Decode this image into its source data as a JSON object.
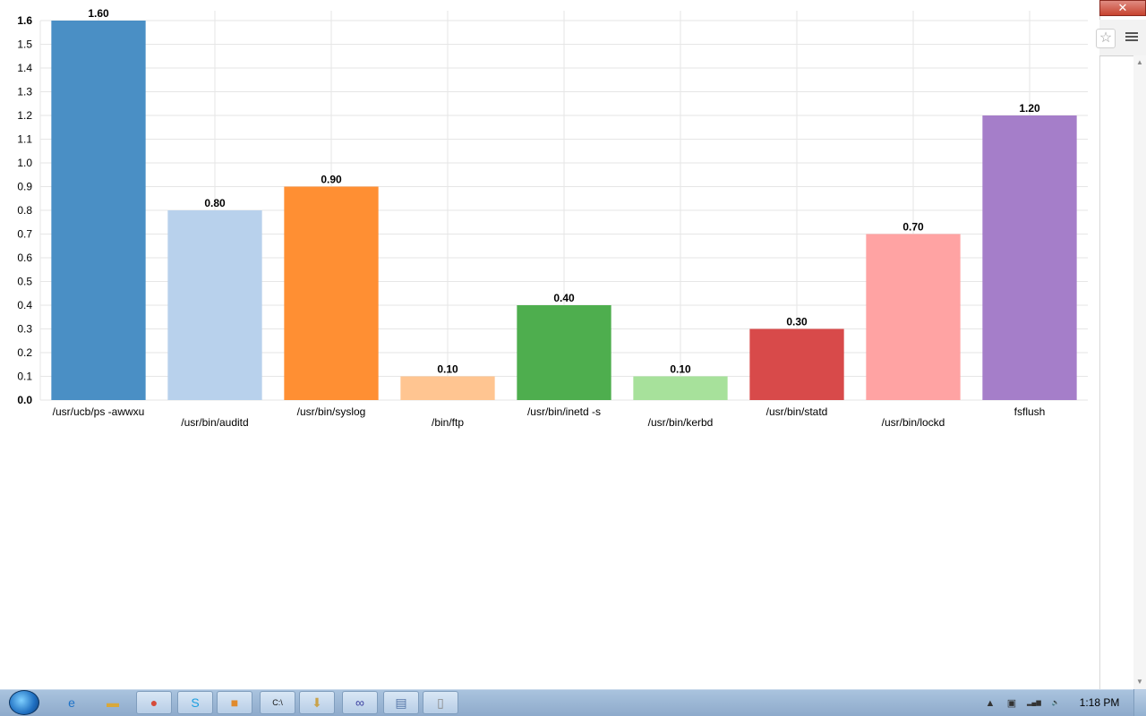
{
  "chart_data": {
    "type": "bar",
    "categories": [
      "/usr/ucb/ps -awwxu",
      "/usr/bin/auditd",
      "/usr/bin/syslog",
      "/bin/ftp",
      "/usr/bin/inetd -s",
      "/usr/bin/kerbd",
      "/usr/bin/statd",
      "/usr/bin/lockd",
      "fsflush"
    ],
    "values": [
      1.6,
      0.8,
      0.9,
      0.1,
      0.4,
      0.1,
      0.3,
      0.7,
      1.2
    ],
    "value_labels": [
      "1.60",
      "0.80",
      "0.90",
      "0.10",
      "0.40",
      "0.10",
      "0.30",
      "0.70",
      "1.20"
    ],
    "colors": [
      "#4a8fc5",
      "#b8d1ec",
      "#ff8f33",
      "#ffc591",
      "#4eae4e",
      "#a7e19b",
      "#d84a4a",
      "#ffa3a3",
      "#a57ec9"
    ],
    "y_ticks": [
      "0.0",
      "0.1",
      "0.2",
      "0.3",
      "0.4",
      "0.5",
      "0.6",
      "0.7",
      "0.8",
      "0.9",
      "1.0",
      "1.1",
      "1.2",
      "1.3",
      "1.4",
      "1.5",
      "1.6"
    ],
    "ylim": [
      0,
      1.6
    ],
    "grid": true,
    "legend": "none",
    "title": "",
    "xlabel": "",
    "ylabel": ""
  },
  "browser": {
    "close_glyph": "✕",
    "star_icon": "star-icon",
    "menu_icon": "menu-icon"
  },
  "taskbar": {
    "clock": "1:18 PM",
    "items": [
      {
        "name": "internet-explorer-icon",
        "glyph": "e",
        "color": "#1e73c8"
      },
      {
        "name": "folder-icon",
        "glyph": "▬",
        "color": "#d9a83a"
      },
      {
        "name": "chrome-icon",
        "glyph": "●",
        "color": "#d64b3a"
      },
      {
        "name": "skype-icon",
        "glyph": "S",
        "color": "#1b9fe0"
      },
      {
        "name": "app-icon",
        "glyph": "■",
        "color": "#e08a2d"
      },
      {
        "name": "command-prompt-icon",
        "glyph": "C:\\",
        "color": "#111111"
      },
      {
        "name": "downloads-icon",
        "glyph": "⬇",
        "color": "#c9a24a"
      },
      {
        "name": "infinity-icon",
        "glyph": "∞",
        "color": "#3b3fa0"
      },
      {
        "name": "window-icon",
        "glyph": "▤",
        "color": "#5576a8"
      },
      {
        "name": "document-icon",
        "glyph": "▯",
        "color": "#888888"
      }
    ],
    "tray": [
      {
        "name": "tray-up-arrow-icon",
        "glyph": "▲"
      },
      {
        "name": "network-device-icon",
        "glyph": "▣"
      },
      {
        "name": "signal-icon",
        "glyph": "▂▄▆"
      },
      {
        "name": "volume-icon",
        "glyph": "🔈"
      }
    ]
  }
}
